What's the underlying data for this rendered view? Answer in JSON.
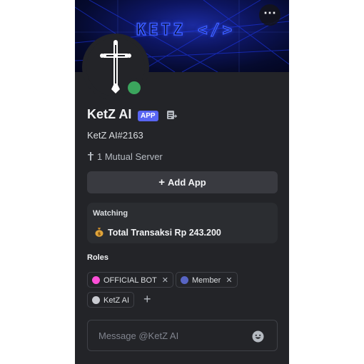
{
  "banner": {
    "text": "KETZ </>"
  },
  "header": {
    "more_label": "⋯"
  },
  "profile": {
    "display_name": "KetZ AI",
    "badge": "APP",
    "tag": "KetZ AI#2163",
    "mutual_servers": "1 Mutual Server",
    "status_color": "#3ba55d"
  },
  "actions": {
    "add_app": "Add App",
    "add_icon": "+"
  },
  "activity": {
    "header": "Watching",
    "icon": "money-bag-icon",
    "text": "Total Transaksi Rp 243.200"
  },
  "roles": {
    "title": "Roles",
    "items": [
      {
        "label": "OFFICIAL BOT",
        "color": "#ff4fd8",
        "removable": true
      },
      {
        "label": "Member",
        "color": "#5865c4",
        "removable": true
      },
      {
        "label": "KetZ AI",
        "color": "#c9cbd1",
        "removable": false
      }
    ],
    "remove_glyph": "✕",
    "add_glyph": "+"
  },
  "message": {
    "placeholder": "Message @KetZ AI"
  },
  "colors": {
    "card_bg": "#232428",
    "accent": "#5865f2"
  }
}
